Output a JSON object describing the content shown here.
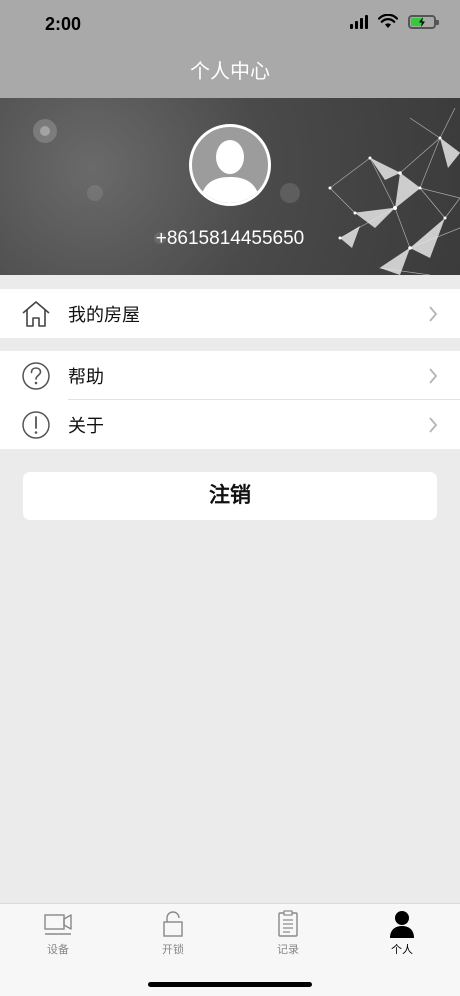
{
  "status_bar": {
    "time": "2:00"
  },
  "nav": {
    "title": "个人中心"
  },
  "profile": {
    "phone": "+8615814455650",
    "avatar_icon": "user-silhouette-icon"
  },
  "menu": {
    "group1": [
      {
        "label": "我的房屋",
        "icon": "house-icon"
      }
    ],
    "group2": [
      {
        "label": "帮助",
        "icon": "question-circle-icon"
      },
      {
        "label": "关于",
        "icon": "exclamation-circle-icon"
      }
    ]
  },
  "logout": {
    "label": "注销"
  },
  "tabs": [
    {
      "label": "设备",
      "icon": "camera-icon",
      "active": false
    },
    {
      "label": "开锁",
      "icon": "unlock-icon",
      "active": false
    },
    {
      "label": "记录",
      "icon": "clipboard-icon",
      "active": false
    },
    {
      "label": "个人",
      "icon": "person-icon",
      "active": true
    }
  ],
  "colors": {
    "header_gray": "#a9a9a9",
    "page_background": "#ebebeb",
    "battery_green": "#36c93b",
    "active_tab": "#000000",
    "inactive_tab": "#888888"
  }
}
